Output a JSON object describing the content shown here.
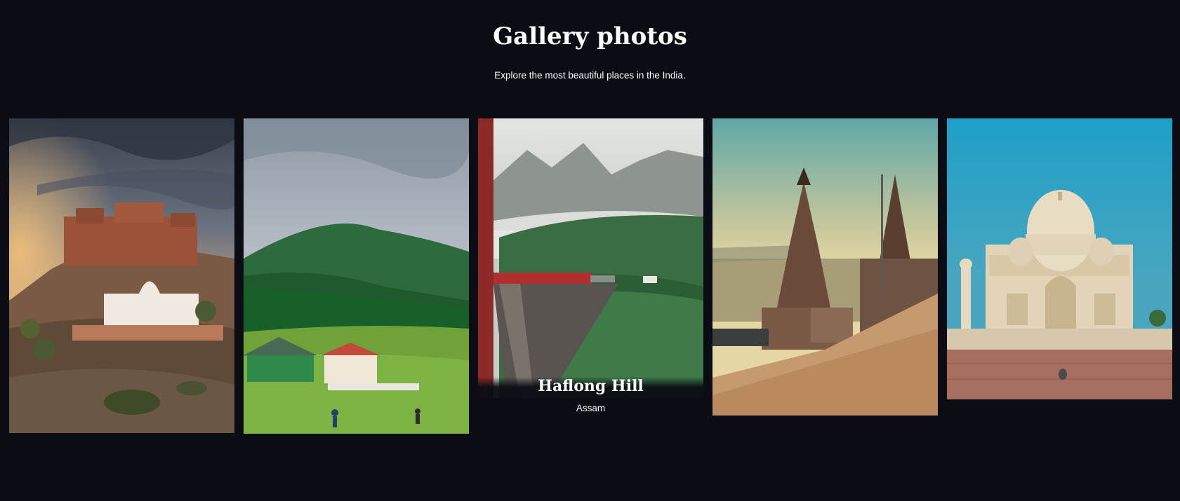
{
  "header": {
    "title": "Gallery photos",
    "subtitle": "Explore the most beautiful places in the India."
  },
  "gallery": {
    "cards": [
      {
        "scene": "fort-on-hill-photo"
      },
      {
        "scene": "green-valley-photo"
      },
      {
        "scene": "mountain-train-photo",
        "title": "Haflong Hill",
        "subtitle": "Assam"
      },
      {
        "scene": "ghat-temple-photo"
      },
      {
        "scene": "taj-mahal-photo"
      }
    ]
  },
  "colors": {
    "background": "#0a0d14",
    "text": "#ffffff"
  }
}
